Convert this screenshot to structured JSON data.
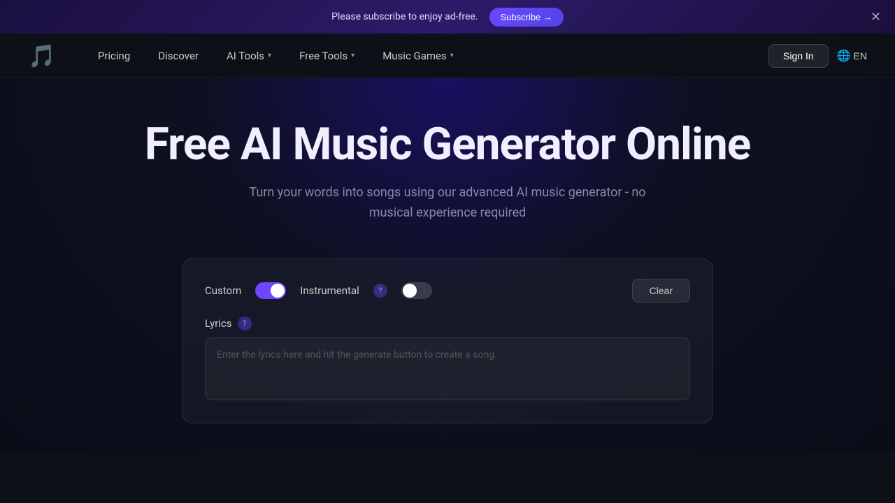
{
  "banner": {
    "text": "Please subscribe to enjoy ad-free.",
    "subscribe_label": "Subscribe →",
    "close_aria": "close"
  },
  "nav": {
    "logo_emoji": "🎵",
    "links": [
      {
        "label": "Pricing",
        "has_dropdown": false
      },
      {
        "label": "Discover",
        "has_dropdown": false
      },
      {
        "label": "AI Tools",
        "has_dropdown": true
      },
      {
        "label": "Free Tools",
        "has_dropdown": true
      },
      {
        "label": "Music Games",
        "has_dropdown": true
      }
    ],
    "sign_in_label": "Sign In",
    "lang_label": "EN"
  },
  "hero": {
    "title": "Free AI Music Generator Online",
    "subtitle": "Turn your words into songs using our advanced AI music generator - no musical experience required"
  },
  "card": {
    "custom_label": "Custom",
    "custom_toggle": "on",
    "instrumental_label": "Instrumental",
    "instrumental_toggle": "off",
    "clear_label": "Clear",
    "lyrics_label": "Lyrics",
    "lyrics_placeholder": "Enter the lyrics here and hit the generate button to create a song."
  },
  "colors": {
    "accent": "#6c47ff",
    "bg_dark": "#0d1117"
  }
}
